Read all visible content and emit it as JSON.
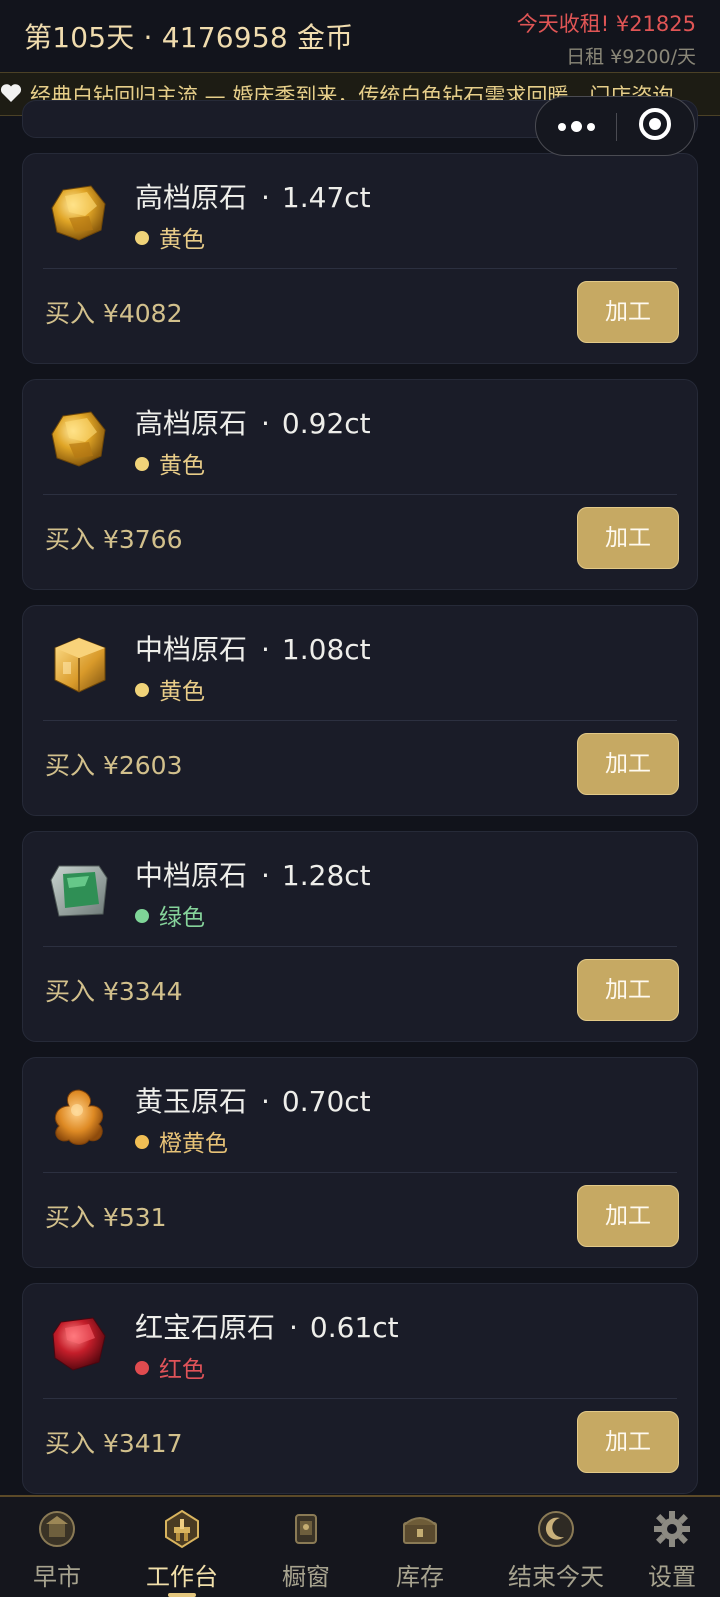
{
  "header": {
    "day_gold": "第105天 · 4176958 金币",
    "rent_message": "今天收租! ¥21825",
    "daily_rent": "日租 ¥9200/天"
  },
  "ticker": {
    "icon": "heart-icon",
    "text": "经典白钻回归主流 — 婚庆季到来，传统白色钻石需求回暖，门店咨询"
  },
  "cards": [
    {
      "name": "高档原石",
      "sep": "·",
      "carat": "1.47ct",
      "color_label": "黄色",
      "dot_color": "#f0d379",
      "text_color": "#e8cc88",
      "price": "买入 ¥4082",
      "button": "加工",
      "gem": "yellow-rough-gem"
    },
    {
      "name": "高档原石",
      "sep": "·",
      "carat": "0.92ct",
      "color_label": "黄色",
      "dot_color": "#f0d379",
      "text_color": "#e8cc88",
      "price": "买入 ¥3766",
      "button": "加工",
      "gem": "yellow-rough-gem"
    },
    {
      "name": "中档原石",
      "sep": "·",
      "carat": "1.08ct",
      "color_label": "黄色",
      "dot_color": "#f0d379",
      "text_color": "#e8cc88",
      "price": "买入 ¥2603",
      "button": "加工",
      "gem": "yellow-cube-gem"
    },
    {
      "name": "中档原石",
      "sep": "·",
      "carat": "1.28ct",
      "color_label": "绿色",
      "dot_color": "#7fd598",
      "text_color": "#86d49b",
      "price": "买入 ¥3344",
      "button": "加工",
      "gem": "green-gem"
    },
    {
      "name": "黄玉原石",
      "sep": "·",
      "carat": "0.70ct",
      "color_label": "橙黄色",
      "dot_color": "#f1be54",
      "text_color": "#e7c277",
      "price": "买入 ¥531",
      "button": "加工",
      "gem": "orange-topaz-gem"
    },
    {
      "name": "红宝石原石",
      "sep": "·",
      "carat": "0.61ct",
      "color_label": "红色",
      "dot_color": "#e04b4f",
      "text_color": "#e05359",
      "price": "买入 ¥3417",
      "button": "加工",
      "gem": "red-ruby-gem"
    }
  ],
  "nav": [
    {
      "label": "早市",
      "icon": "market-icon",
      "active": false
    },
    {
      "label": "工作台",
      "icon": "workbench-icon",
      "active": true
    },
    {
      "label": "橱窗",
      "icon": "showcase-icon",
      "active": false
    },
    {
      "label": "库存",
      "icon": "storage-chest-icon",
      "active": false
    },
    {
      "label": "结束今天",
      "icon": "moon-end-day-icon",
      "active": false
    },
    {
      "label": "设置",
      "icon": "gear-icon",
      "active": false
    }
  ]
}
